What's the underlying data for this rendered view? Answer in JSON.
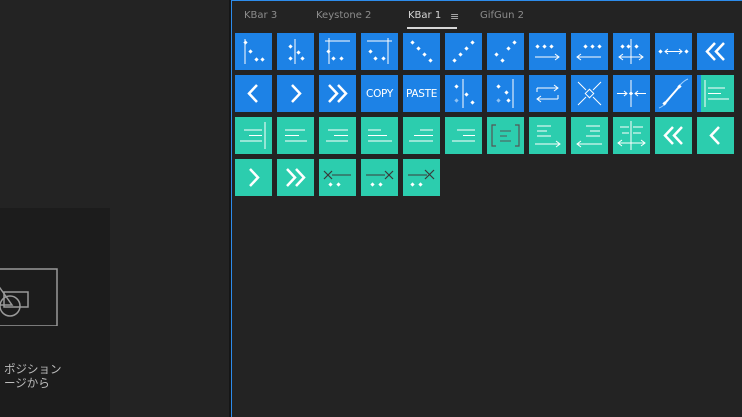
{
  "left": {
    "composition_text_line1": "ポジション",
    "composition_text_line2": "ージから"
  },
  "tabs": [
    {
      "label": "KBar 3",
      "active": false
    },
    {
      "label": "Keystone 2",
      "active": false
    },
    {
      "label": "KBar 1",
      "active": true
    },
    {
      "label": "GifGun 2",
      "active": false
    }
  ],
  "tab_menu_icon": "≡",
  "buttons": {
    "copy": "COPY",
    "paste": "PASTE"
  },
  "colors": {
    "accent_blue": "#1d82e6",
    "accent_teal": "#2ccdae",
    "panel_border": "#2d8ceb",
    "background": "#232323"
  }
}
